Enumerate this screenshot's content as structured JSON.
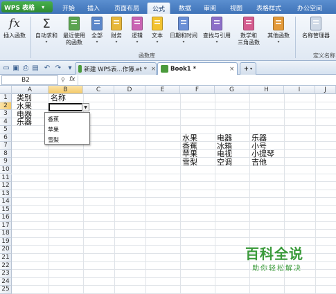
{
  "app": {
    "logo": "WPS 表格"
  },
  "menu_tabs": [
    "开始",
    "插入",
    "页面布局",
    "公式",
    "数据",
    "审阅",
    "视图",
    "表格样式",
    "办公空间"
  ],
  "active_tab": "公式",
  "ribbon": {
    "insert_function": "插入函数",
    "autosum": "自动求和",
    "recent": [
      "最近使用",
      "的函数"
    ],
    "all": "全部",
    "finance": "财务",
    "logic": "逻辑",
    "text": "文本",
    "datetime": "日期和时间",
    "lookup": "查找与引用",
    "math": [
      "数学和",
      "三角函数"
    ],
    "other": "其他函数",
    "name_manager": "名称管理器",
    "group_label": "函数库",
    "group_label2": "定义名称"
  },
  "doc_tabs": [
    {
      "label": "新建 WPS表...作簿.et *",
      "close": "×"
    },
    {
      "label": "Book1 *",
      "close": "×"
    }
  ],
  "new_tab": "+",
  "formula_bar": {
    "name_box": "B2",
    "fx": "fx"
  },
  "columns": [
    "A",
    "B",
    "C",
    "D",
    "E",
    "F",
    "G",
    "H",
    "I",
    "J"
  ],
  "rows": [
    "1",
    "2",
    "3",
    "4",
    "5",
    "6",
    "7",
    "8",
    "9",
    "10",
    "11",
    "12",
    "13",
    "14",
    "15",
    "16",
    "17",
    "18",
    "19",
    "20",
    "21",
    "22",
    "23",
    "24",
    "25"
  ],
  "cells": {
    "A1": "类别",
    "B1": "名称",
    "A2": "水果",
    "A3": "电器",
    "A4": "乐器",
    "F6": "水果",
    "G6": "电器",
    "H6": "乐器",
    "F7": "香蕉",
    "G7": "冰箱",
    "H7": "小号",
    "F8": "苹果",
    "G8": "电视",
    "H8": "小提琴",
    "F9": "雪梨",
    "G9": "空调",
    "H9": "吉他"
  },
  "dropdown": {
    "items": [
      "香蕉",
      "苹果",
      "雪梨"
    ]
  },
  "watermark": {
    "title": "百科全说",
    "subtitle": "助你轻松解决"
  },
  "colors": {
    "title_bar": "#4a7fc4",
    "ribbon": "#e6edf6",
    "selected_header": "#f5d27a",
    "watermark": "#3a9a3a"
  }
}
